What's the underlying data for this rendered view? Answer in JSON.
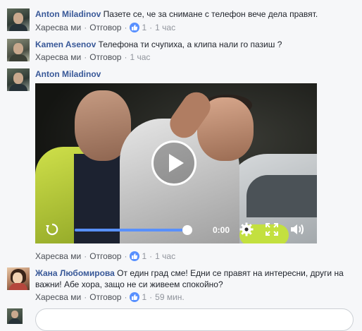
{
  "comments": [
    {
      "author": "Anton Miladinov",
      "text": "Пазете се, че за снимане с телефон вече дела правят.",
      "like_label": "Харесва ми",
      "reply_label": "Отговор",
      "likes": "1",
      "time": "1 час"
    },
    {
      "author": "Kamen Asenov",
      "text": "Телефона ти счупиха, а клипа нали го пазиш ?",
      "like_label": "Харесва ми",
      "reply_label": "Отговор",
      "time": "1 час"
    },
    {
      "author": "Anton Miladinov",
      "like_label": "Харесва ми",
      "reply_label": "Отговор",
      "likes": "1",
      "time": "1 час",
      "video": {
        "time": "0:00",
        "progress": 1.0
      }
    },
    {
      "author": "Жана Любомирова",
      "text": "От един град сме! Едни се правят на интересни, други на важни! Абе хора, защо не си живеем спокойно?",
      "like_label": "Харесва ми",
      "reply_label": "Отговор",
      "likes": "1",
      "time": "59 мин."
    }
  ],
  "colors": {
    "author": "#385898",
    "accent": "#5890ff",
    "meta": "#90949c"
  }
}
